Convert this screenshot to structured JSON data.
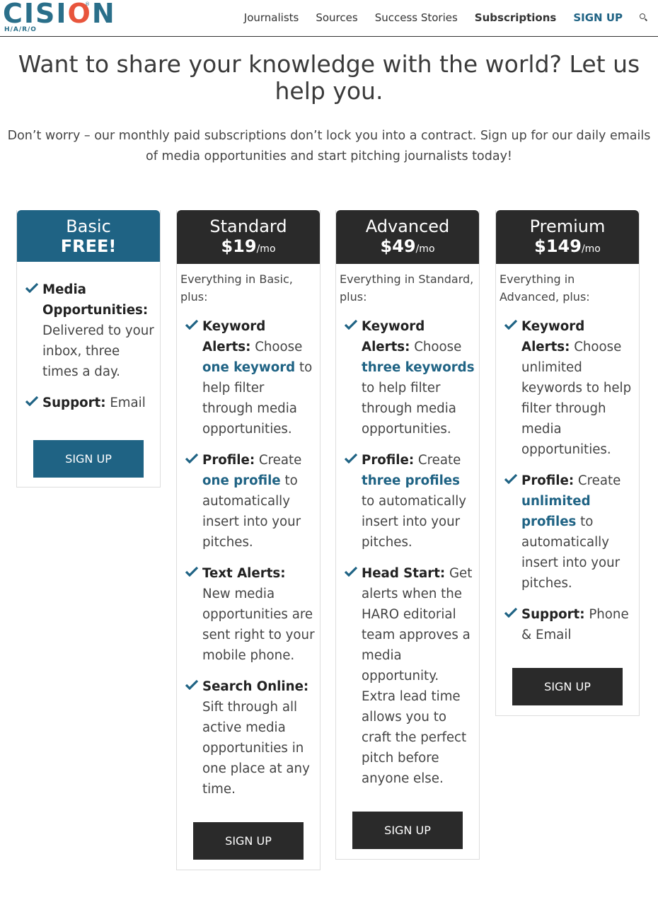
{
  "brand": {
    "name_part1": "CISI",
    "name_o": "O",
    "name_part2": "N",
    "reg": "®",
    "sub": "H/A/R/O",
    "colors": {
      "primary": "#1f6384",
      "accent": "#e8553c",
      "dark": "#2a2a2a"
    }
  },
  "nav": {
    "items": [
      {
        "label": "Journalists"
      },
      {
        "label": "Sources"
      },
      {
        "label": "Success Stories"
      },
      {
        "label": "Subscriptions",
        "active": true
      },
      {
        "label": "SIGN UP"
      }
    ],
    "search_icon": "search-icon"
  },
  "hero": {
    "title": "Want to share your knowledge with the world? Let us help you.",
    "subtitle": "Don’t worry – our monthly paid subscriptions don’t lock you into a contract. Sign up for our daily emails of media opportunities and start pitching journalists today!"
  },
  "plans": [
    {
      "name": "Basic",
      "price": "FREE!",
      "unit": "",
      "intro": "",
      "features": [
        {
          "title": "Media Opportunities:",
          "parts": [
            {
              "t": " Delivered to your inbox, three times a day."
            }
          ]
        },
        {
          "title": "Support:",
          "parts": [
            {
              "t": " Email"
            }
          ]
        }
      ],
      "button": "SIGN UP"
    },
    {
      "name": "Standard",
      "price": "$19",
      "unit": "/mo",
      "intro": "Everything in Basic, plus:",
      "features": [
        {
          "title": "Keyword Alerts:",
          "parts": [
            {
              "t": " Choose "
            },
            {
              "t": "one keyword",
              "hl": true
            },
            {
              "t": " to help filter through media opportunities."
            }
          ]
        },
        {
          "title": "Profile:",
          "parts": [
            {
              "t": " Create "
            },
            {
              "t": "one profile",
              "hl": true
            },
            {
              "t": " to automatically insert into your pitches."
            }
          ]
        },
        {
          "title": "Text Alerts:",
          "parts": [
            {
              "t": " New media opportunities are sent right to your mobile phone."
            }
          ]
        },
        {
          "title": "Search Online:",
          "parts": [
            {
              "t": " Sift through all active media opportunities in one place at any time."
            }
          ]
        }
      ],
      "button": "SIGN UP"
    },
    {
      "name": "Advanced",
      "price": "$49",
      "unit": "/mo",
      "intro": "Everything in Standard, plus:",
      "features": [
        {
          "title": "Keyword Alerts:",
          "parts": [
            {
              "t": " Choose "
            },
            {
              "t": "three keywords",
              "hl": true
            },
            {
              "t": " to help filter through media opportunities."
            }
          ]
        },
        {
          "title": "Profile:",
          "parts": [
            {
              "t": " Create "
            },
            {
              "t": "three profiles",
              "hl": true
            },
            {
              "t": " to automatically insert into your pitches."
            }
          ]
        },
        {
          "title": "Head Start:",
          "parts": [
            {
              "t": " Get alerts when the HARO editorial team approves a media opportunity. Extra lead time allows you to craft the perfect pitch before anyone else."
            }
          ]
        }
      ],
      "button": "SIGN UP"
    },
    {
      "name": "Premium",
      "price": "$149",
      "unit": "/mo",
      "intro": "Everything in Advanced, plus:",
      "features": [
        {
          "title": "Keyword Alerts:",
          "parts": [
            {
              "t": " Choose unlimited keywords to help filter through media opportunities."
            }
          ]
        },
        {
          "title": "Profile:",
          "parts": [
            {
              "t": " Create "
            },
            {
              "t": "unlimited profiles",
              "hl": true
            },
            {
              "t": " to automatically insert into your pitches."
            }
          ]
        },
        {
          "title": "Support:",
          "parts": [
            {
              "t": " Phone & Email"
            }
          ]
        }
      ],
      "button": "SIGN UP"
    }
  ]
}
